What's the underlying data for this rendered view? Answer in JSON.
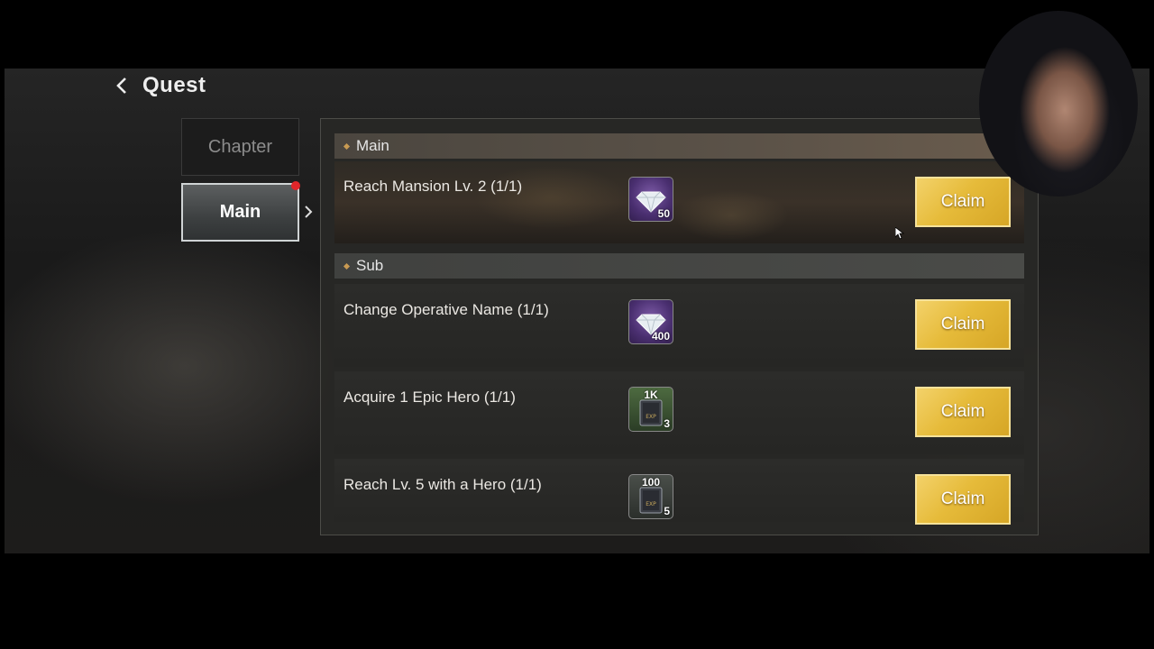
{
  "header": {
    "title": "Quest"
  },
  "tabs": {
    "chapter_label": "Chapter",
    "main_label": "Main"
  },
  "sections": {
    "main_title": "Main",
    "sub_title": "Sub"
  },
  "main_quest": {
    "text": "Reach Mansion Lv. 2 (1/1)",
    "reward": {
      "icon": "diamond-icon",
      "count": "50"
    },
    "claim_label": "Claim"
  },
  "sub_quests": [
    {
      "text": "Change Operative Name (1/1)",
      "reward": {
        "icon": "diamond-icon",
        "count": "400"
      },
      "claim_label": "Claim"
    },
    {
      "text": "Acquire 1 Epic Hero (1/1)",
      "reward": {
        "icon": "exp-book-icon",
        "top": "1K",
        "count": "3"
      },
      "claim_label": "Claim"
    },
    {
      "text": "Reach Lv. 5 with a Hero (1/1)",
      "reward": {
        "icon": "exp-book-icon",
        "top": "100",
        "count": "5"
      },
      "claim_label": "Claim"
    }
  ],
  "colors": {
    "claim_gold": "#e6bb3a",
    "notification_red": "#e0262a",
    "accent_bronze": "#c89a52"
  }
}
